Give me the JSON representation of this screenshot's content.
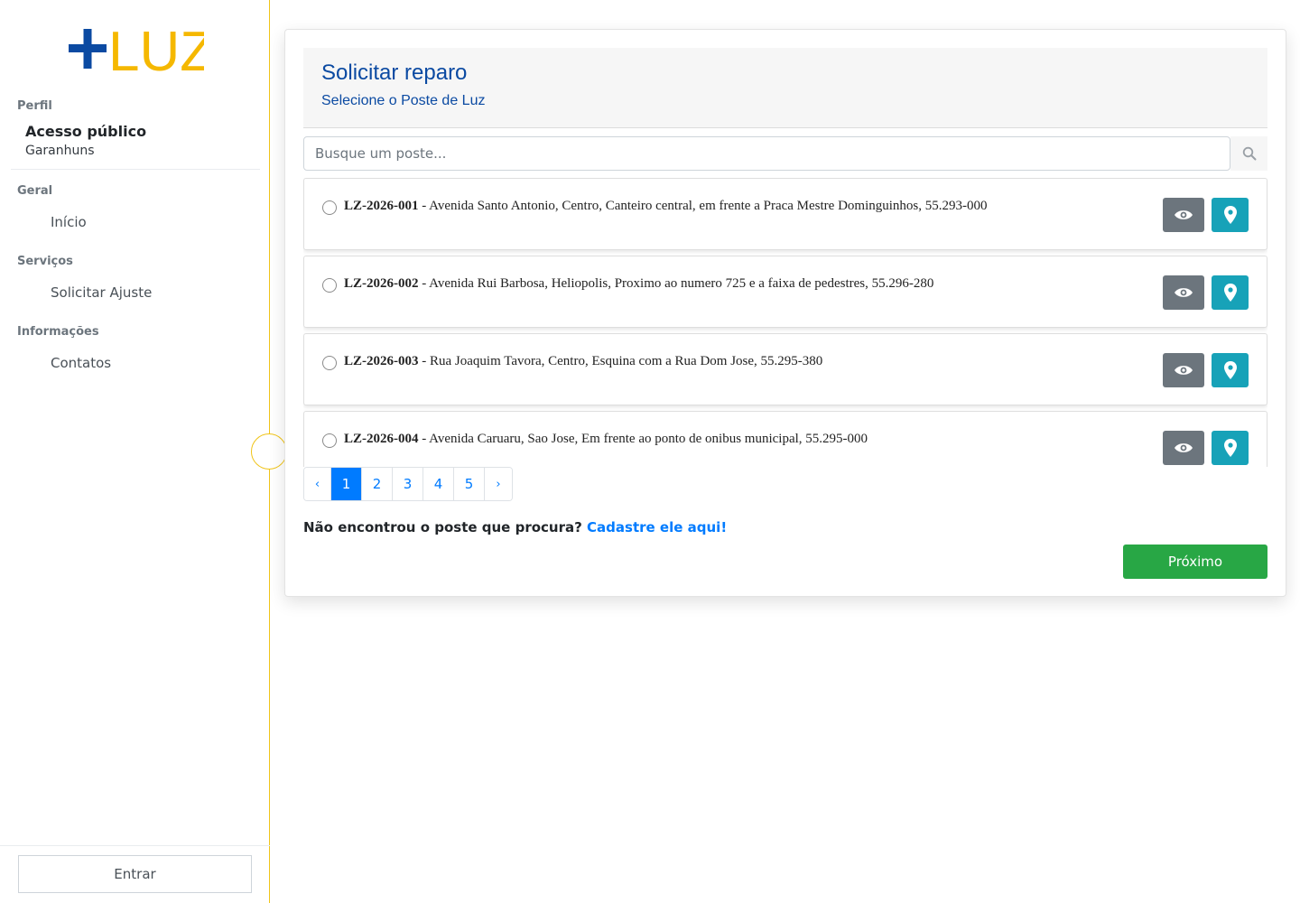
{
  "brand": {
    "logo_plus": "+",
    "logo_text": "LUZ",
    "colors": {
      "blue": "#0b4aa2",
      "yellow": "#f5b800"
    }
  },
  "sidebar": {
    "profile_label": "Perfil",
    "profile_name": "Acesso público",
    "profile_city": "Garanhuns",
    "sections": [
      {
        "label": "Geral",
        "items": [
          {
            "label": "Início"
          }
        ]
      },
      {
        "label": "Serviços",
        "items": [
          {
            "label": "Solicitar Ajuste"
          }
        ]
      },
      {
        "label": "Informações",
        "items": [
          {
            "label": "Contatos"
          }
        ]
      }
    ],
    "login_label": "Entrar"
  },
  "main": {
    "title": "Solicitar reparo",
    "subtitle": "Selecione o Poste de Luz",
    "search": {
      "placeholder": "Busque um poste...",
      "icon": "search-icon"
    },
    "poles": [
      {
        "code": "LZ-2026-001",
        "address": " - Avenida Santo Antonio, Centro, Canteiro central, em frente a Praca Mestre Dominguinhos, 55.293-000"
      },
      {
        "code": "LZ-2026-002",
        "address": " - Avenida Rui Barbosa, Heliopolis, Proximo ao numero 725 e a faixa de pedestres, 55.296-280"
      },
      {
        "code": "LZ-2026-003",
        "address": " - Rua Joaquim Tavora, Centro, Esquina com a Rua Dom Jose, 55.295-380"
      },
      {
        "code": "LZ-2026-004",
        "address": " - Avenida Caruaru, Sao Jose, Em frente ao ponto de onibus municipal, 55.295-000"
      }
    ],
    "pagination": {
      "prev": "‹",
      "pages": [
        "1",
        "2",
        "3",
        "4",
        "5"
      ],
      "next": "›",
      "current": "1"
    },
    "not_found_text": "Não encontrou o poste que procura?",
    "not_found_link": "Cadastre ele aqui!",
    "next_label": "Próximo",
    "colors": {
      "view_button": "#6c757d",
      "map_button": "#17a2b8",
      "next_button": "#28a745",
      "link": "#007bff"
    }
  }
}
